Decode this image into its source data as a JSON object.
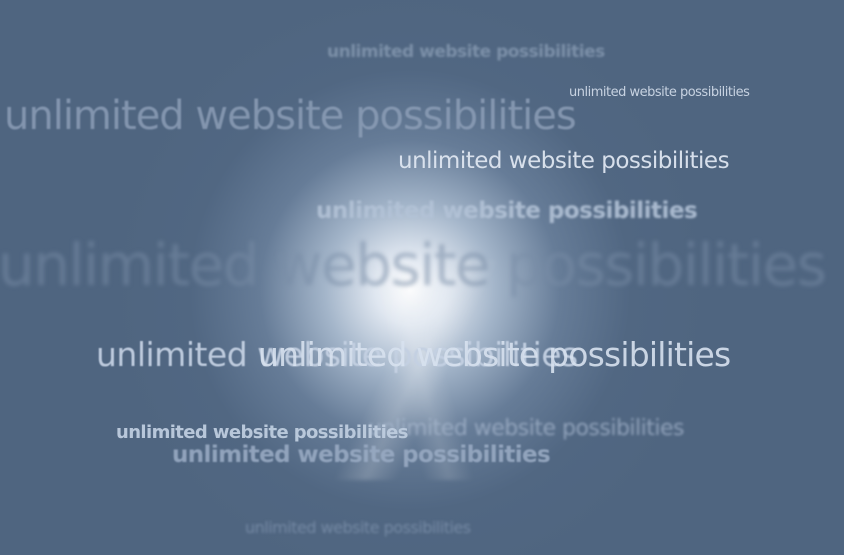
{
  "phrases": [
    "unlimited website possibilities",
    "unlimited website possibilities",
    "unlimited website possibilities",
    "unlimited website possibilities",
    "unlimited website possibilities",
    "unlimited website possibilities",
    "unlimited website possibilities",
    "unlimited website possibilities",
    "unlimited website possibilities",
    "unlimited website possibilities",
    "unlimited website possibilities",
    "unlimited website possibilities"
  ],
  "colors": {
    "background": "#4f6580",
    "glow": "#ffffff"
  }
}
